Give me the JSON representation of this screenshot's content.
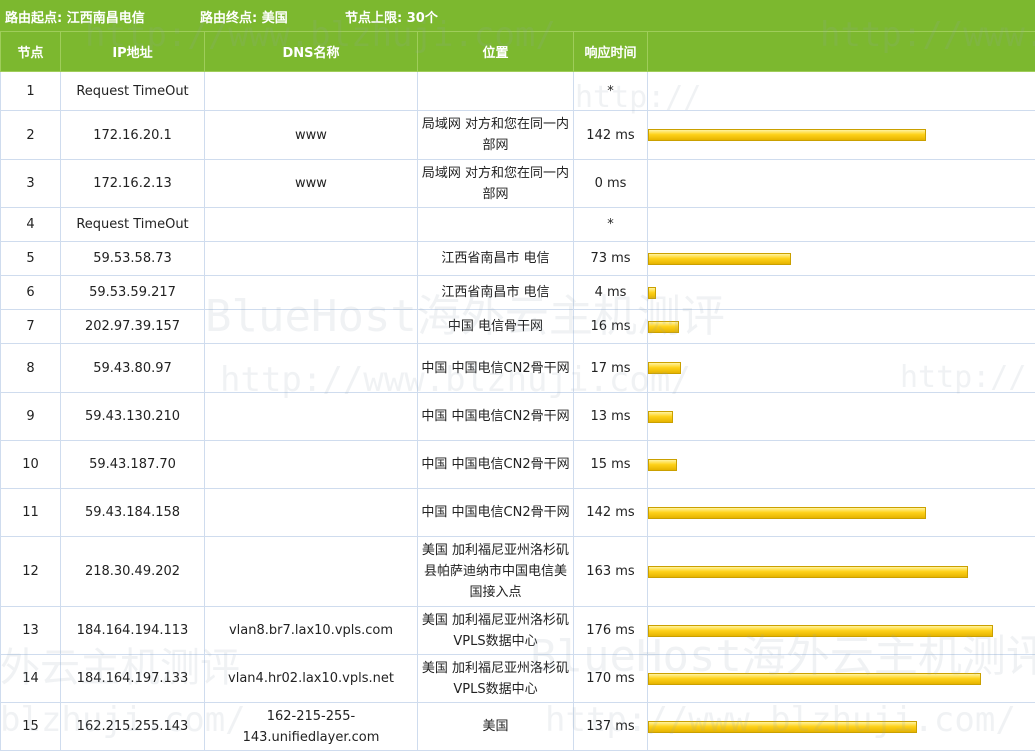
{
  "header": {
    "start": "路由起点: 江西南昌电信",
    "end": "路由终点: 美国",
    "limit": "节点上限: 30个"
  },
  "columns": {
    "node": "节点",
    "ip": "IP地址",
    "dns": "DNS名称",
    "location": "位置",
    "time": "响应时间"
  },
  "max_time_ms": 176,
  "rows": [
    {
      "node": "1",
      "ip": "Request TimeOut",
      "dns": "",
      "location": "",
      "time": "*",
      "ms": null
    },
    {
      "node": "2",
      "ip": "172.16.20.1",
      "dns": "www",
      "location": "局域网 对方和您在同一内部网",
      "time": "142 ms",
      "ms": 142
    },
    {
      "node": "3",
      "ip": "172.16.2.13",
      "dns": "www",
      "location": "局域网 对方和您在同一内部网",
      "time": "0 ms",
      "ms": 0
    },
    {
      "node": "4",
      "ip": "Request TimeOut",
      "dns": "",
      "location": "",
      "time": "*",
      "ms": null
    },
    {
      "node": "5",
      "ip": "59.53.58.73",
      "dns": "",
      "location": "江西省南昌市 电信",
      "time": "73 ms",
      "ms": 73
    },
    {
      "node": "6",
      "ip": "59.53.59.217",
      "dns": "",
      "location": "江西省南昌市 电信",
      "time": "4 ms",
      "ms": 4
    },
    {
      "node": "7",
      "ip": "202.97.39.157",
      "dns": "",
      "location": "中国 电信骨干网",
      "time": "16 ms",
      "ms": 16
    },
    {
      "node": "8",
      "ip": "59.43.80.97",
      "dns": "",
      "location": "中国 中国电信CN2骨干网",
      "time": "17 ms",
      "ms": 17
    },
    {
      "node": "9",
      "ip": "59.43.130.210",
      "dns": "",
      "location": "中国 中国电信CN2骨干网",
      "time": "13 ms",
      "ms": 13
    },
    {
      "node": "10",
      "ip": "59.43.187.70",
      "dns": "",
      "location": "中国 中国电信CN2骨干网",
      "time": "15 ms",
      "ms": 15
    },
    {
      "node": "11",
      "ip": "59.43.184.158",
      "dns": "",
      "location": "中国 中国电信CN2骨干网",
      "time": "142 ms",
      "ms": 142
    },
    {
      "node": "12",
      "ip": "218.30.49.202",
      "dns": "",
      "location": "美国 加利福尼亚州洛杉矶县帕萨迪纳市中国电信美国接入点",
      "time": "163 ms",
      "ms": 163
    },
    {
      "node": "13",
      "ip": "184.164.194.113",
      "dns": "vlan8.br7.lax10.vpls.com",
      "location": "美国 加利福尼亚州洛杉矶VPLS数据中心",
      "time": "176 ms",
      "ms": 176
    },
    {
      "node": "14",
      "ip": "184.164.197.133",
      "dns": "vlan4.hr02.lax10.vpls.net",
      "location": "美国 加利福尼亚州洛杉矶VPLS数据中心",
      "time": "170 ms",
      "ms": 170
    },
    {
      "node": "15",
      "ip": "162.215.255.143",
      "dns": "162-215-255-143.unifiedlayer.com",
      "location": "美国",
      "time": "137 ms",
      "ms": 137
    }
  ],
  "watermarks": [
    "http://www.blzhuji.com/",
    "BlueHost海外云主机测评",
    "http://www.blzhuji.com/",
    "BlueHost海外云主机测评",
    "外云主机测评",
    "http://www.blzhuji.com/",
    "http://www.blzhuji.com/",
    "blzhuji.com/",
    "http://",
    "http://"
  ],
  "colors": {
    "header_bg": "#7cb82f",
    "bar_fill": "#ffd21a",
    "grid": "#cfdcee"
  }
}
